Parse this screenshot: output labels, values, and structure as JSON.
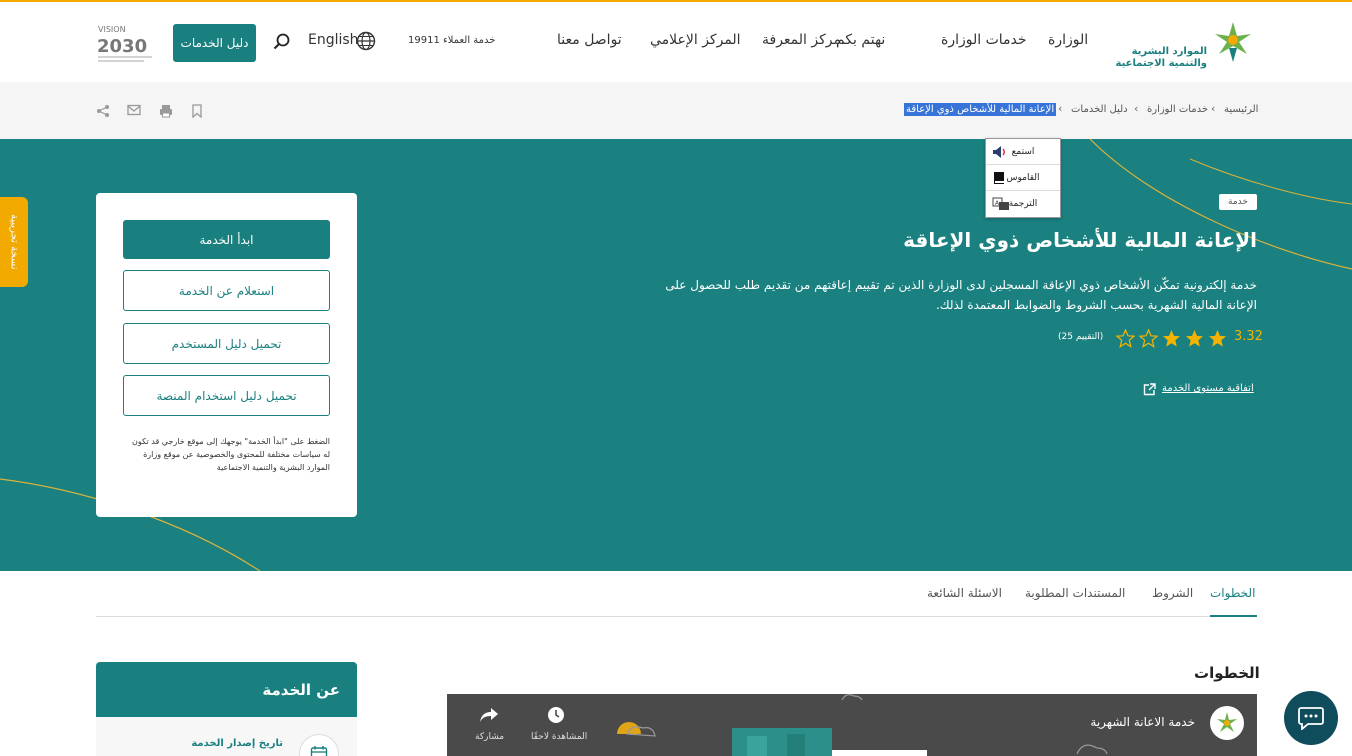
{
  "header": {
    "logo_text_line1": "الموارد البشرية",
    "logo_text_line2": "والتنمية الاجتماعية",
    "nav": [
      "الوزارة",
      "خدمات الوزارة",
      "نهتم بكم",
      "مركز المعرفة",
      "المركز الإعلامي",
      "تواصل معنا"
    ],
    "hotline": "خدمة العملاء 19911",
    "language": "English",
    "services_guide_button": "دليل الخدمات",
    "vision_logo": "VISION 2030"
  },
  "breadcrumb": {
    "items": [
      "الرئيسية",
      "خدمات الوزارة",
      "دليل الخدمات"
    ],
    "current": "الإعانة المالية للأشخاص ذوي الإعاقة"
  },
  "context_popup": {
    "items": [
      {
        "label": "استمع",
        "icon": "speaker-icon"
      },
      {
        "label": "القاموس",
        "icon": "book-icon"
      },
      {
        "label": "الترجمة",
        "icon": "translate-icon"
      }
    ]
  },
  "hero": {
    "tag": "خدمة",
    "title": "الإعانة المالية للأشخاص ذوي الإعاقة",
    "description": "خدمة إلكترونية تمكّن الأشخاص ذوي الإعاقة المسجلين لدى الوزارة الذين تم تقييم إعاقتهم من تقديم طلب للحصول على الإعانة المالية الشهرية بحسب الشروط والضوابط المعتمدة لذلك.",
    "rating_value": "3.32",
    "rating_stars_filled": 3,
    "rating_stars_total": 5,
    "rating_count": "(التقييم 25)",
    "sla_link": "اتفاقية مستوى الخدمة"
  },
  "card": {
    "start_button": "ابدأ الخدمة",
    "inquiry_button": "استعلام عن الخدمة",
    "user_guide_button": "تحميل دليل المستخدم",
    "platform_guide_button": "تحميل دليل استخدام المنصة",
    "note": "الضغط على \"ابدأ الخدمة\" يوجهك إلى موقع خارجي قد تكون له سياسات مختلفة للمحتوى والخصوصية عن موقع وزارة الموارد البشرية والتنمية الاجتماعية"
  },
  "side_tab": "نسخة تجريبية",
  "tabs": [
    "الخطوات",
    "الشروط",
    "المستندات المطلوبة",
    "الاسئلة الشائعة"
  ],
  "steps_heading": "الخطوات",
  "video": {
    "title": "خدمة الاعانة الشهرية",
    "watch_later": "المشاهدة لاحقًا",
    "share": "مشاركة"
  },
  "about": {
    "heading": "عن الخدمة",
    "release_date_label": "تاريخ إصدار الخدمة"
  },
  "colors": {
    "teal": "#1a8080",
    "accent": "#f2a900",
    "chat": "#0f4c5c"
  }
}
